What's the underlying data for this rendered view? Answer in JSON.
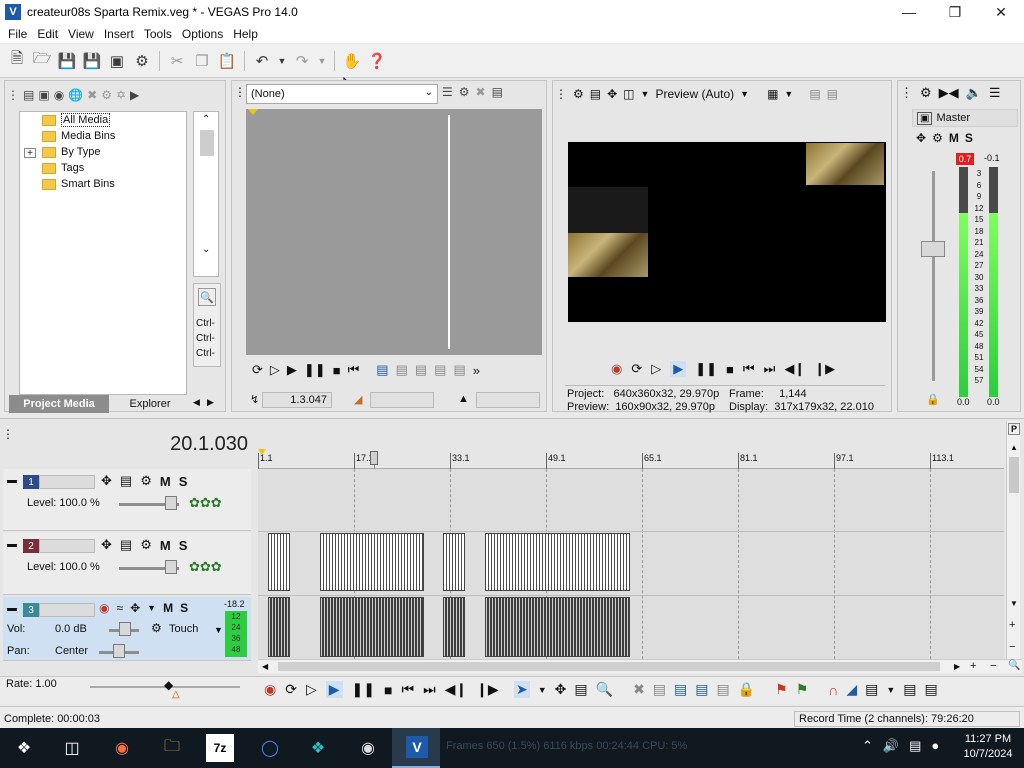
{
  "window": {
    "title": "createur08s Sparta Remix.veg * - VEGAS Pro 14.0",
    "logo": "V"
  },
  "menu": [
    "File",
    "Edit",
    "View",
    "Insert",
    "Tools",
    "Options",
    "Help"
  ],
  "project_media": {
    "tree": [
      {
        "label": "All Media",
        "selected": true
      },
      {
        "label": "Media Bins"
      },
      {
        "label": "By Type",
        "expandable": true
      },
      {
        "label": "Tags"
      },
      {
        "label": "Smart Bins"
      }
    ],
    "side_labels": [
      "Ctrl-",
      "Ctrl-",
      "Ctrl-"
    ],
    "tabs": {
      "project_media": "Project Media",
      "explorer": "Explorer"
    },
    "expand_glyph": "+"
  },
  "trimmer": {
    "dropdown_value": "(None)",
    "time": "1.3.047"
  },
  "preview": {
    "quality": "Preview (Auto)",
    "info": {
      "project_label": "Project:",
      "project_value": "640x360x32, 29.970p",
      "preview_label": "Preview:",
      "preview_value": "160x90x32, 29.970p",
      "frame_label": "Frame:",
      "frame_value": "1,144",
      "display_label": "Display:",
      "display_value": "317x179x32, 22.010"
    }
  },
  "master": {
    "title": "Master",
    "peak_left": "0.7",
    "peak_right": "-0.1",
    "scale": [
      "3",
      "6",
      "9",
      "12",
      "15",
      "18",
      "21",
      "24",
      "27",
      "30",
      "33",
      "36",
      "39",
      "42",
      "45",
      "48",
      "51",
      "54",
      "57"
    ],
    "bottom_left": "0.0",
    "bottom_right": "0.0",
    "mute": "M",
    "solo": "S"
  },
  "timeline": {
    "cursor_time": "20.1.030",
    "ruler": [
      "1.1",
      "17.1",
      "33.1",
      "49.1",
      "65.1",
      "81.1",
      "97.1",
      "113.1"
    ],
    "tracks": [
      {
        "number": "1",
        "level": "Level: 100.0 %",
        "color": "#2c4a8c",
        "m": "M",
        "s": "S"
      },
      {
        "number": "2",
        "level": "Level: 100.0 %",
        "color": "#7a2d3d",
        "m": "M",
        "s": "S"
      },
      {
        "number": "3",
        "vol": "Vol:",
        "vol_value": "0.0 dB",
        "pan": "Pan:",
        "pan_value": "Center",
        "touch": "Touch",
        "color": "#3a8a9a",
        "m": "M",
        "s": "S",
        "meter_top": "-18.2",
        "meter_marks": [
          "12",
          "24",
          "36",
          "48"
        ]
      }
    ]
  },
  "transport": {
    "rate": "Rate: 1.00"
  },
  "status": {
    "complete": "Complete: 00:00:03",
    "record_time": "Record Time (2 channels): 79:26:20"
  },
  "taskbar": {
    "time": "11:27 PM",
    "date": "10/7/2024",
    "app_7z": "7z",
    "ghost_text": "Frames 650 (1.5%)  6116 kbps  00:24:44  CPU: 5%"
  },
  "colors": {
    "accent": "#1d5aa8",
    "selected_track_bg": "#cfe0f2",
    "meter_green": "#2ecc40",
    "peak_red": "#e02020"
  }
}
